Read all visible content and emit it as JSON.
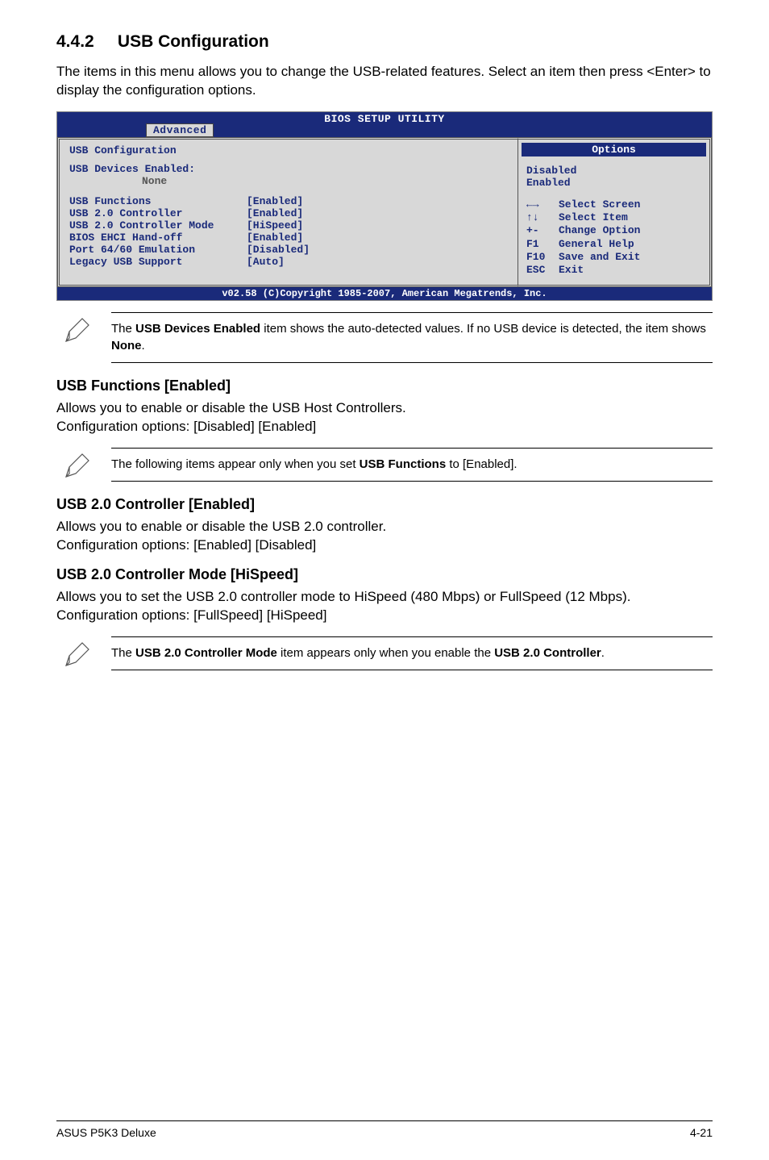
{
  "section": {
    "number": "4.4.2",
    "title": "USB Configuration",
    "intro": "The items in this menu allows you to change the USB-related features. Select an item then press <Enter> to display the configuration options."
  },
  "bios": {
    "title": "BIOS SETUP UTILITY",
    "active_tab": "Advanced",
    "panel_title": "USB Configuration",
    "devices_label": "USB Devices Enabled:",
    "devices_value": "None",
    "rows": [
      {
        "label": "USB Functions",
        "value": "[Enabled]"
      },
      {
        "label": "USB 2.0 Controller",
        "value": "[Enabled]"
      },
      {
        "label": "USB 2.0 Controller Mode",
        "value": "[HiSpeed]"
      },
      {
        "label": "BIOS EHCI Hand-off",
        "value": "[Enabled]"
      },
      {
        "label": "Port 64/60 Emulation",
        "value": "[Disabled]"
      },
      {
        "label": "Legacy USB Support",
        "value": "[Auto]"
      }
    ],
    "options_header": "Options",
    "options": {
      "opt1": "Disabled",
      "opt2": "Enabled"
    },
    "help": {
      "r1": {
        "k": "←→",
        "v": "Select Screen"
      },
      "r2": {
        "k": "↑↓",
        "v": "Select Item"
      },
      "r3": {
        "k": "+-",
        "v": "Change Option"
      },
      "r4": {
        "k": "F1",
        "v": "General Help"
      },
      "r5": {
        "k": "F10",
        "v": "Save and Exit"
      },
      "r6": {
        "k": "ESC",
        "v": "Exit"
      }
    },
    "footer": "v02.58 (C)Copyright 1985-2007, American Megatrends, Inc."
  },
  "notes": {
    "n1_pre": "The ",
    "n1_bold1": "USB Devices Enabled",
    "n1_mid": " item shows the auto-detected values. If no USB device is detected, the item shows ",
    "n1_bold2": "None",
    "n1_post": ".",
    "n2_pre": "The following items appear only when you set ",
    "n2_bold": "USB Functions",
    "n2_post": " to [Enabled].",
    "n3_pre": "The ",
    "n3_bold1": "USB 2.0 Controller Mode",
    "n3_mid": " item appears only when you enable the ",
    "n3_bold2": "USB 2.0 Controller",
    "n3_post": "."
  },
  "subs": {
    "usb_functions": {
      "heading": "USB Functions [Enabled]",
      "line1": "Allows you to enable or disable the USB Host Controllers.",
      "line2": "Configuration options: [Disabled] [Enabled]"
    },
    "usb20_controller": {
      "heading": "USB 2.0 Controller [Enabled]",
      "line1": "Allows you to enable or disable the USB 2.0 controller.",
      "line2": "Configuration options: [Enabled] [Disabled]"
    },
    "usb20_mode": {
      "heading": "USB 2.0 Controller Mode [HiSpeed]",
      "line1": "Allows you to set the USB 2.0 controller mode to HiSpeed (480 Mbps) or FullSpeed (12 Mbps). Configuration options: [FullSpeed] [HiSpeed]"
    }
  },
  "footer": {
    "left": "ASUS P5K3 Deluxe",
    "right": "4-21"
  }
}
